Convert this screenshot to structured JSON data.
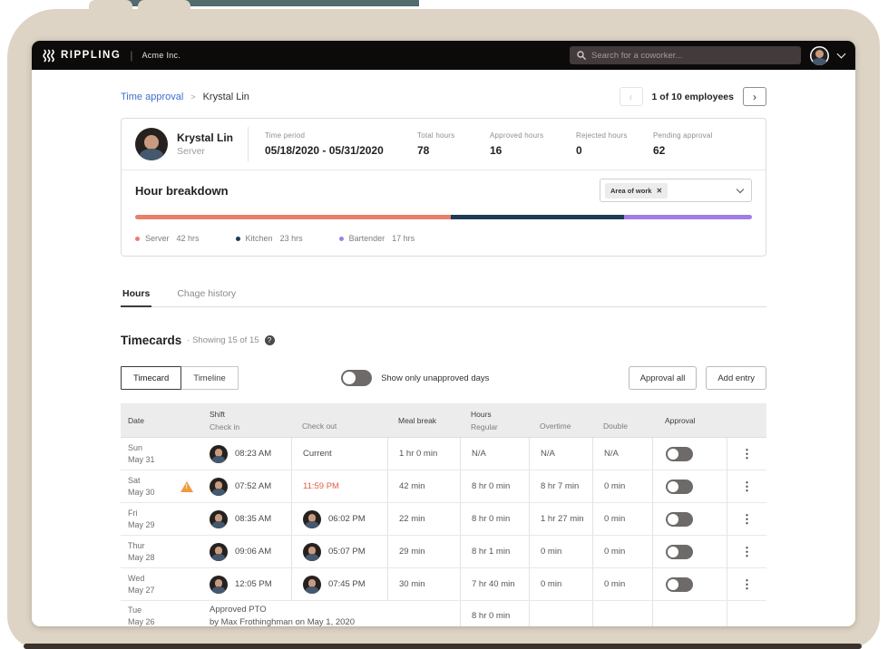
{
  "colors": {
    "link_blue": "#3f6ed0",
    "alert_time": "#df5f49",
    "warning": "#f09a3e",
    "frame_beige": "#ded4c5",
    "topbar_black": "#0d0a0a",
    "teal_strip": "#516b6e"
  },
  "icons": {
    "kebab": "⋮",
    "help": "?",
    "close": "✕",
    "prev": "‹",
    "next": "›"
  },
  "topbar": {
    "brand": "RIPPLING",
    "separator": "|",
    "company": "Acme Inc.",
    "search_placeholder": "Search for a coworker..."
  },
  "breadcrumb": {
    "parent": "Time approval",
    "separator": ">",
    "current": "Krystal Lin"
  },
  "pagination": {
    "label": "1 of 10 employees"
  },
  "summary": {
    "name": "Krystal Lin",
    "role": "Server",
    "stats": [
      {
        "label": "Time period",
        "value": "05/18/2020 - 05/31/2020"
      },
      {
        "label": "Total hours",
        "value": "78"
      },
      {
        "label": "Approved hours",
        "value": "16"
      },
      {
        "label": "Rejected hours",
        "value": "0"
      },
      {
        "label": "Pending approval",
        "value": "62"
      }
    ],
    "breakdown": {
      "title": "Hour breakdown",
      "filter_tag": "Area of work",
      "segments": [
        {
          "label": "Server",
          "hours": 42,
          "hours_label": "42 hrs",
          "color": "#e87f6b",
          "pct": 51.2
        },
        {
          "label": "Kitchen",
          "hours": 23,
          "hours_label": "23 hrs",
          "color": "#1d3c55",
          "pct": 28.0
        },
        {
          "label": "Bartender",
          "hours": 17,
          "hours_label": "17 hrs",
          "color": "#a07ee3",
          "pct": 20.8
        }
      ]
    }
  },
  "tabs": [
    {
      "label": "Hours"
    },
    {
      "label": "Chage history"
    }
  ],
  "timecards": {
    "title": "Timecards",
    "subtitle": "· Showing 15 of 15",
    "view_buttons": [
      {
        "label": "Timecard"
      },
      {
        "label": "Timeline"
      }
    ],
    "toggle_label": "Show only unapproved days",
    "actions": [
      {
        "label": "Approval all"
      },
      {
        "label": "Add entry"
      }
    ]
  },
  "table": {
    "header": {
      "date": "Date",
      "shift": "Shift",
      "check_in": "Check in",
      "check_out": "Check out",
      "meal": "Meal break",
      "hours": "Hours",
      "regular": "Regular",
      "overtime": "Overtime",
      "double": "Double",
      "approval": "Approval"
    },
    "rows": [
      {
        "day": "Sun",
        "date": "May 31",
        "check_in": "08:23 AM",
        "check_out": "Current",
        "meal": "1 hr 0 min",
        "regular": "N/A",
        "overtime": "N/A",
        "double": "N/A"
      },
      {
        "day": "Sat",
        "date": "May 30",
        "check_in": "07:52 AM",
        "check_out": "11:59 PM",
        "meal": "42 min",
        "regular": "8 hr 0 min",
        "overtime": "8 hr 7 min",
        "double": "0 min"
      },
      {
        "day": "Fri",
        "date": "May 29",
        "check_in": "08:35 AM",
        "check_out": "06:02 PM",
        "meal": "22 min",
        "regular": "8 hr 0 min",
        "overtime": "1 hr 27 min",
        "double": "0 min"
      },
      {
        "day": "Thur",
        "date": "May 28",
        "check_in": "09:06 AM",
        "check_out": "05:07 PM",
        "meal": "29 min",
        "regular": "8 hr 1 min",
        "overtime": "0 min",
        "double": "0 min"
      },
      {
        "day": "Wed",
        "date": "May 27",
        "check_in": "12:05 PM",
        "check_out": "07:45 PM",
        "meal": "30 min",
        "regular": "7 hr 40 min",
        "overtime": "0 min",
        "double": "0 min"
      },
      {
        "day": "Tue",
        "date": "May 26",
        "pto_line1": "Approved PTO",
        "pto_line2": "by Max Frothinghman on May 1, 2020",
        "regular": "8 hr 0 min"
      }
    ]
  }
}
